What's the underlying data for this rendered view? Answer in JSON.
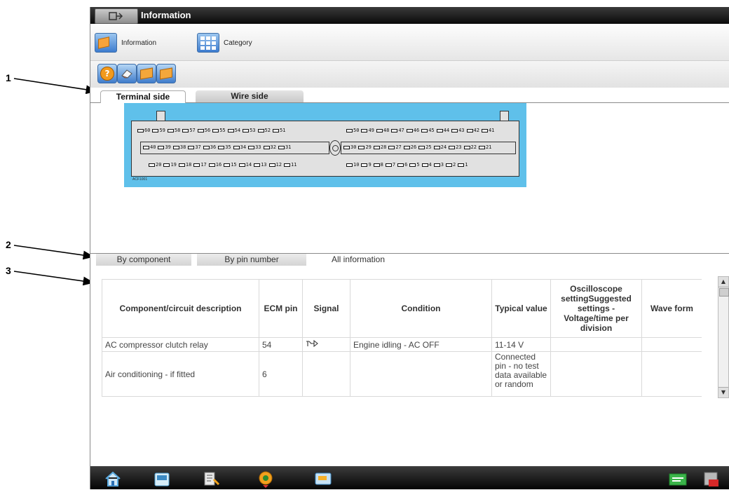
{
  "callouts": [
    "1",
    "2",
    "3"
  ],
  "window": {
    "title": "Information",
    "title_icon": "information-window-icon"
  },
  "toolbar": {
    "information_label": "Information",
    "category_label": "Category",
    "tools": [
      "help-icon",
      "eraser-icon",
      "document-icon",
      "document-icon"
    ]
  },
  "view_tabs": {
    "terminal_side": "Terminal side",
    "wire_side": "Wire side",
    "selected": "Terminal side"
  },
  "connector": {
    "label": "ACF1001",
    "row_top_left": [
      "60",
      "59",
      "58",
      "57",
      "56",
      "55",
      "54",
      "53",
      "52",
      "51"
    ],
    "row_top_right": [
      "50",
      "49",
      "48",
      "47",
      "46",
      "45",
      "44",
      "43",
      "42",
      "41"
    ],
    "row_mid_left": [
      "40",
      "39",
      "38",
      "37",
      "36",
      "35",
      "34",
      "33",
      "32",
      "31"
    ],
    "row_mid_right": [
      "30",
      "29",
      "28",
      "27",
      "26",
      "25",
      "24",
      "23",
      "22",
      "21"
    ],
    "row_bot_left": [
      "20",
      "19",
      "18",
      "17",
      "16",
      "15",
      "14",
      "13",
      "12",
      "11"
    ],
    "row_bot_right": [
      "10",
      "9",
      "8",
      "7",
      "6",
      "5",
      "4",
      "3",
      "2",
      "1"
    ]
  },
  "info_tabs": {
    "by_component": "By component",
    "by_pin_number": "By pin number",
    "all_information": "All information",
    "selected": "All information"
  },
  "table": {
    "headers": {
      "component": "Component/circuit description",
      "ecm_pin": "ECM pin",
      "signal": "Signal",
      "condition": "Condition",
      "typical": "Typical value",
      "oscilloscope": "Oscilloscope settingSuggested settings - Voltage/time per division",
      "waveform": "Wave form"
    },
    "rows": [
      {
        "component": "AC compressor clutch relay",
        "ecm_pin": "54",
        "signal_icon": "switch-output-signal-icon",
        "condition": "Engine idling - AC OFF",
        "typical": "11-14 V",
        "oscilloscope": "",
        "waveform": ""
      },
      {
        "component": "Air conditioning - if fitted",
        "ecm_pin": "6",
        "signal_icon": "",
        "condition": "",
        "typical": "Connected pin - no test data available or random",
        "oscilloscope": "",
        "waveform": ""
      }
    ]
  },
  "taskbar": {
    "icons": [
      "home-icon",
      "scanner-icon",
      "tools-icon",
      "vehicle-icon",
      "data-icon",
      "shop-icon",
      "exit-icon"
    ]
  }
}
